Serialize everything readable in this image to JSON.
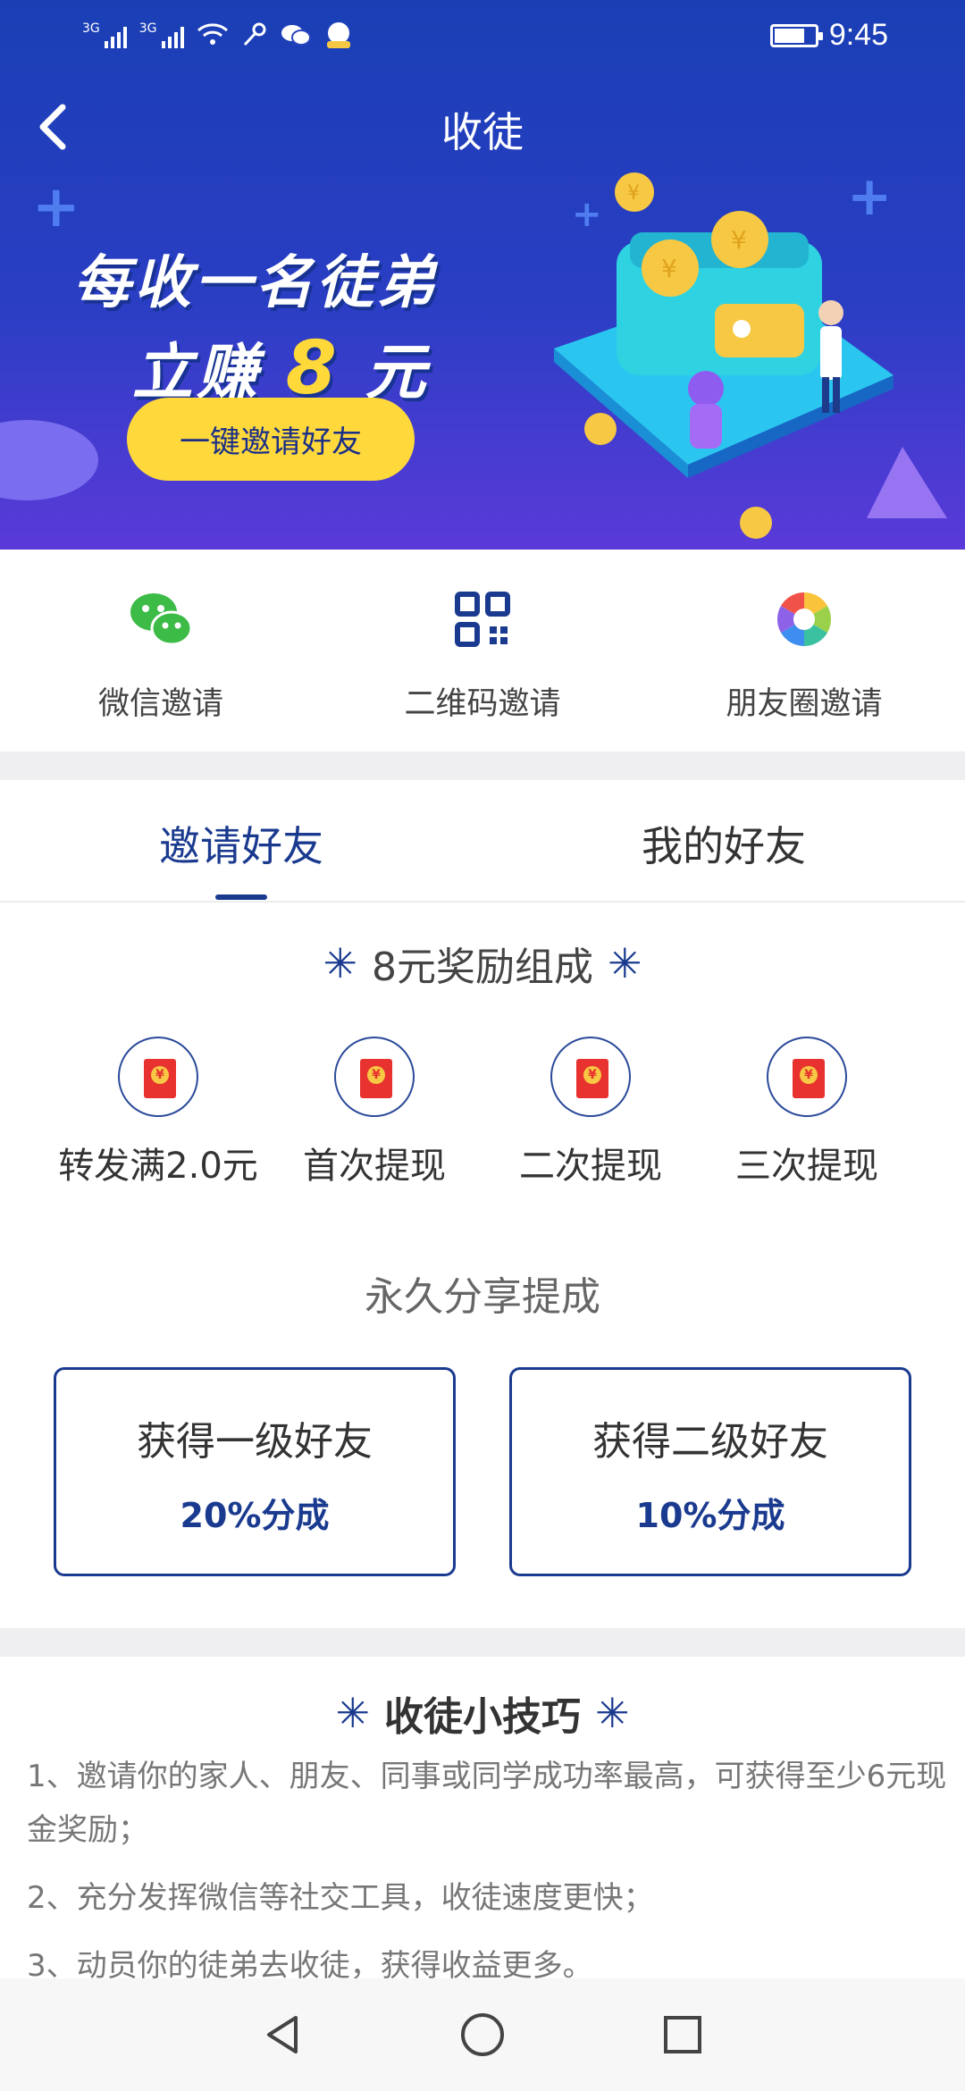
{
  "status_bar": {
    "network_1": "3G",
    "network_2": "3G",
    "time": "9:45"
  },
  "header": {
    "title": "收徒"
  },
  "banner": {
    "line1": "每收一名徒弟",
    "line2_prefix": "立赚",
    "line2_amount": "8",
    "line2_suffix": "元",
    "cta_label": "一键邀请好友"
  },
  "share_options": [
    {
      "label": "微信邀请",
      "icon": "wechat-icon"
    },
    {
      "label": "二维码邀请",
      "icon": "qr-code-icon"
    },
    {
      "label": "朋友圈邀请",
      "icon": "moments-icon"
    }
  ],
  "tabs": [
    {
      "label": "邀请好友",
      "active": true
    },
    {
      "label": "我的好友",
      "active": false
    }
  ],
  "reward_section": {
    "title": "8元奖励组成",
    "items": [
      {
        "label": "转发满2.0元"
      },
      {
        "label": "首次提现"
      },
      {
        "label": "二次提现"
      },
      {
        "label": "三次提现"
      }
    ],
    "share_title": "永久分享提成",
    "cards": [
      {
        "title": "获得一级好友",
        "value": "20%分成"
      },
      {
        "title": "获得二级好友",
        "value": "10%分成"
      }
    ]
  },
  "tips": {
    "title": "收徒小技巧",
    "items": [
      "1、邀请你的家人、朋友、同事或同学成功率最高，可获得至少6元现金奖励；",
      "2、充分发挥微信等社交工具，收徒速度更快；",
      "3、动员你的徒弟去收徒，获得收益更多。"
    ]
  },
  "colors": {
    "primary": "#1a3a8f",
    "banner_top": "#1a3fb5",
    "banner_bottom": "#5a3ad8",
    "cta": "#ffd93c",
    "red_envelope": "#e8322f"
  }
}
